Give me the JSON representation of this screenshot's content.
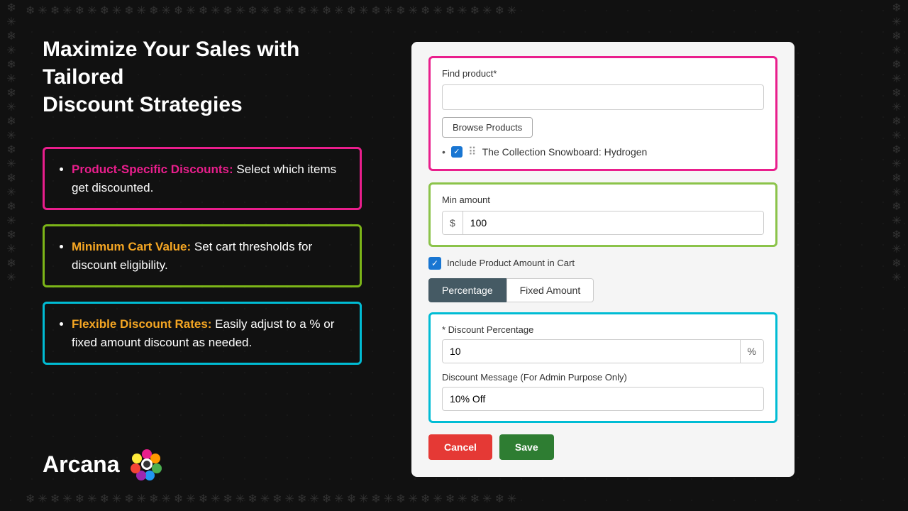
{
  "page": {
    "background": "#111111"
  },
  "header": {
    "title_line1": "Maximize Your Sales with Tailored",
    "title_line2": "Discount Strategies"
  },
  "features": [
    {
      "highlight": "Product-Specific Discounts:",
      "text": " Select which items get discounted.",
      "color": "pink"
    },
    {
      "highlight": "Minimum Cart Value:",
      "text": " Set cart thresholds for discount eligibility.",
      "color": "green"
    },
    {
      "highlight": "Flexible Discount Rates:",
      "text": " Easily adjust to a % or fixed amount discount as needed.",
      "color": "cyan"
    }
  ],
  "logo": {
    "text": "Arcana"
  },
  "find_product": {
    "label": "Find product*",
    "input_value": "",
    "browse_button": "Browse Products",
    "product_name": "The Collection Snowboard: Hydrogen"
  },
  "min_amount": {
    "label": "Min amount",
    "currency_symbol": "$",
    "value": "100"
  },
  "include_checkbox": {
    "label": "Include Product Amount in Cart",
    "checked": true
  },
  "toggle": {
    "options": [
      "Percentage",
      "Fixed Amount"
    ],
    "active": "Percentage"
  },
  "discount_percentage": {
    "label": "* Discount Percentage",
    "value": "10",
    "suffix": "%"
  },
  "discount_message": {
    "label": "Discount Message (For Admin Purpose Only)",
    "value": "10% Off"
  },
  "buttons": {
    "cancel": "Cancel",
    "save": "Save"
  }
}
